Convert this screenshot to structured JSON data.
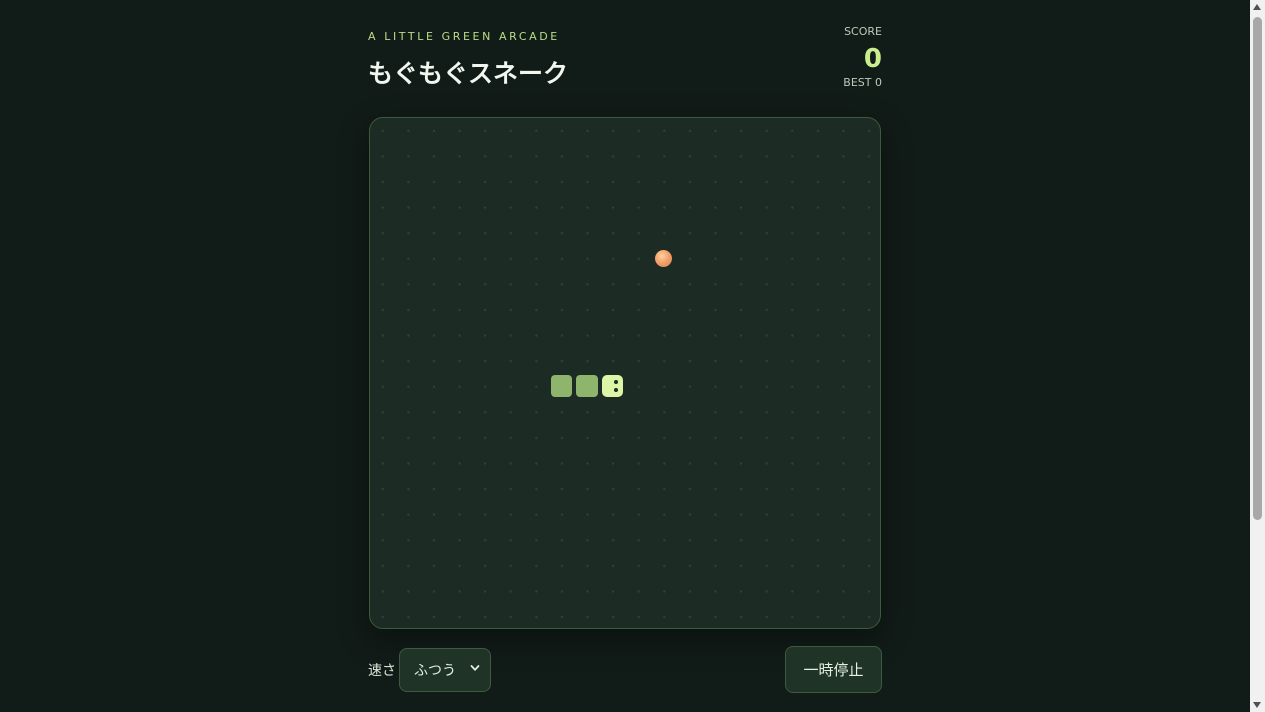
{
  "header": {
    "tagline": "A LITTLE GREEN ARCADE",
    "title": "もぐもぐスネーク"
  },
  "score": {
    "label": "SCORE",
    "value": "0",
    "best": "BEST 0"
  },
  "board": {
    "grid_columns": 20,
    "grid_rows": 20,
    "snake": [
      {
        "col": 9,
        "row": 10,
        "part": "head",
        "direction": "right"
      },
      {
        "col": 8,
        "row": 10,
        "part": "body"
      },
      {
        "col": 7,
        "row": 10,
        "part": "body"
      }
    ],
    "food": {
      "col": 11,
      "row": 5
    }
  },
  "controls": {
    "speed_label": "速さ",
    "speed_selected": "ふつう",
    "pause_label": "一時停止"
  },
  "colors": {
    "background": "#111b18",
    "board": "#1c2b23",
    "snake_body": "#8fb56c",
    "snake_head": "#dcf5a6",
    "food": "#f3a26a",
    "accent": "#c8ee8e"
  }
}
